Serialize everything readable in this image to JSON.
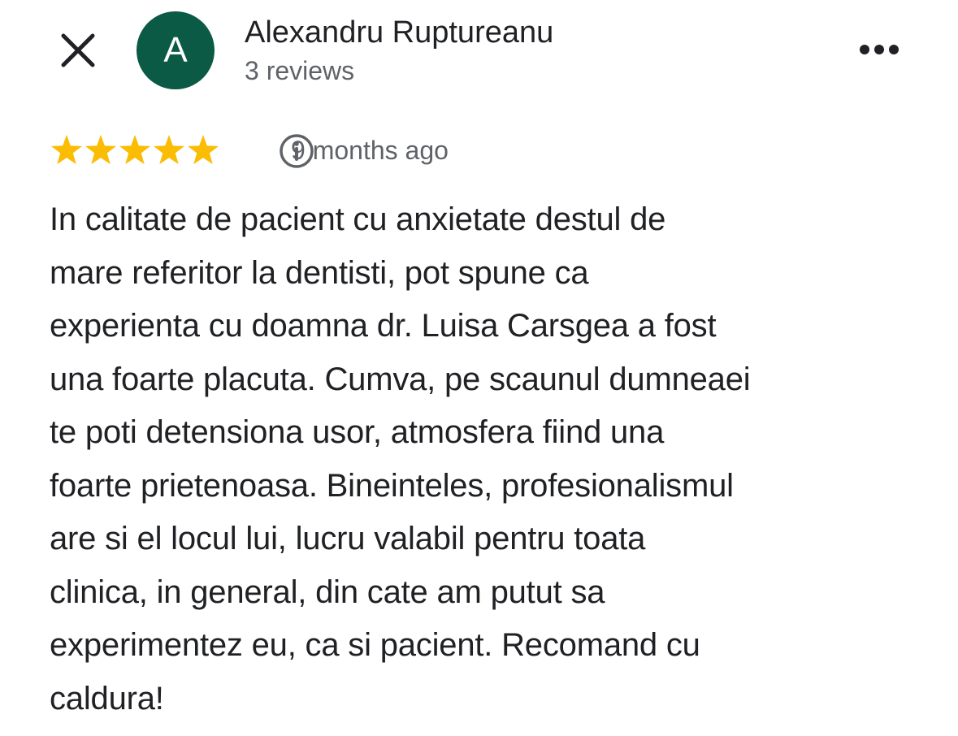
{
  "header": {
    "close_icon": "close-icon",
    "avatar_letter": "A",
    "avatar_color": "#0b5a46",
    "author_name": "Alexandru Ruptureanu",
    "review_count": "3 reviews",
    "more_icon": "more-horizontal-icon"
  },
  "rating": {
    "stars": 5,
    "max_stars": 5,
    "star_color": "#fbbc04",
    "info_icon": "info-icon",
    "date": "9 months ago"
  },
  "review": {
    "text": "In calitate de pacient cu anxietate destul de\nmare referitor la dentisti, pot spune ca\nexperienta cu doamna dr. Luisa Carsgea a fost\nuna foarte placuta. Cumva, pe scaunul dumneaei\nte poti detensiona usor, atmosfera fiind una\nfoarte prietenoasa. Bineinteles, profesionalismul\nare si el locul lui, lucru valabil pentru toata\nclinica, in general, din cate am putut sa\nexperimentez eu, ca si pacient. Recomand cu\ncaldura!"
  }
}
